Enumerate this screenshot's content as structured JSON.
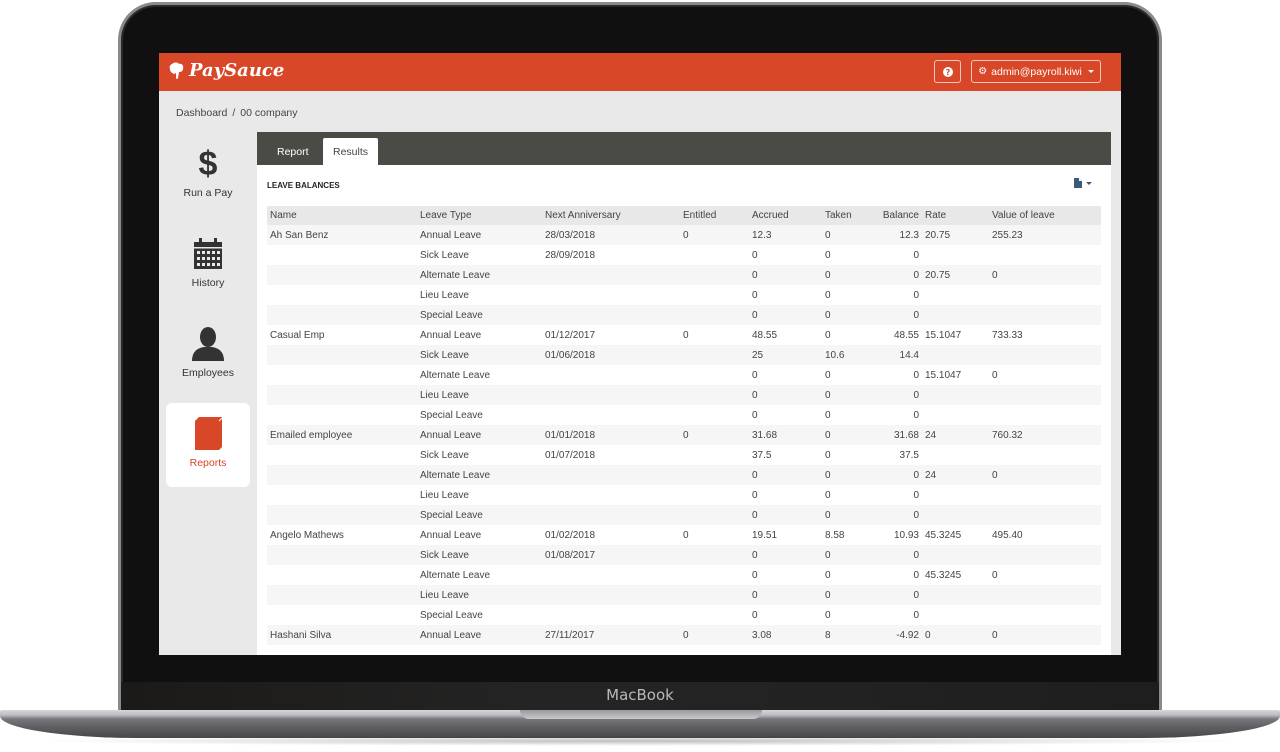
{
  "device": {
    "label": "MacBook"
  },
  "app": {
    "name": "PaySauce",
    "brand_color": "#d84727",
    "tab_bar_color": "#4b4b45"
  },
  "header": {
    "help_icon": "question-circle-icon",
    "user_menu": {
      "icon": "gear-icon",
      "label": "admin@payroll.kiwi"
    }
  },
  "breadcrumb": {
    "items": [
      "Dashboard",
      "/",
      "00 company"
    ]
  },
  "sidebar": {
    "items": [
      {
        "label": "Run a Pay",
        "icon": "dollar-icon",
        "active": false
      },
      {
        "label": "History",
        "icon": "calendar-icon",
        "active": false
      },
      {
        "label": "Employees",
        "icon": "person-icon",
        "active": false
      },
      {
        "label": "Reports",
        "icon": "book-icon",
        "active": true
      }
    ]
  },
  "main": {
    "tabs": [
      {
        "label": "Report",
        "active": false
      },
      {
        "label": "Results",
        "active": true
      }
    ],
    "section_title": "LEAVE BALANCES",
    "export_icon": "file-icon",
    "table": {
      "columns": [
        "Name",
        "Leave Type",
        "Next Anniversary",
        "Entitled",
        "Accrued",
        "Taken",
        "Balance",
        "Rate",
        "Value of leave"
      ],
      "rows": [
        [
          "Ah San Benz",
          "Annual Leave",
          "28/03/2018",
          "0",
          "12.3",
          "0",
          "12.3",
          "20.75",
          "255.23"
        ],
        [
          "",
          "Sick Leave",
          "28/09/2018",
          "",
          "0",
          "0",
          "0",
          "",
          ""
        ],
        [
          "",
          "Alternate Leave",
          "",
          "",
          "0",
          "0",
          "0",
          "20.75",
          "0"
        ],
        [
          "",
          "Lieu Leave",
          "",
          "",
          "0",
          "0",
          "0",
          "",
          ""
        ],
        [
          "",
          "Special Leave",
          "",
          "",
          "0",
          "0",
          "0",
          "",
          ""
        ],
        [
          "Casual Emp",
          "Annual Leave",
          "01/12/2017",
          "0",
          "48.55",
          "0",
          "48.55",
          "15.1047",
          "733.33"
        ],
        [
          "",
          "Sick Leave",
          "01/06/2018",
          "",
          "25",
          "10.6",
          "14.4",
          "",
          ""
        ],
        [
          "",
          "Alternate Leave",
          "",
          "",
          "0",
          "0",
          "0",
          "15.1047",
          "0"
        ],
        [
          "",
          "Lieu Leave",
          "",
          "",
          "0",
          "0",
          "0",
          "",
          ""
        ],
        [
          "",
          "Special Leave",
          "",
          "",
          "0",
          "0",
          "0",
          "",
          ""
        ],
        [
          "Emailed employee",
          "Annual Leave",
          "01/01/2018",
          "0",
          "31.68",
          "0",
          "31.68",
          "24",
          "760.32"
        ],
        [
          "",
          "Sick Leave",
          "01/07/2018",
          "",
          "37.5",
          "0",
          "37.5",
          "",
          ""
        ],
        [
          "",
          "Alternate Leave",
          "",
          "",
          "0",
          "0",
          "0",
          "24",
          "0"
        ],
        [
          "",
          "Lieu Leave",
          "",
          "",
          "0",
          "0",
          "0",
          "",
          ""
        ],
        [
          "",
          "Special Leave",
          "",
          "",
          "0",
          "0",
          "0",
          "",
          ""
        ],
        [
          "Angelo Mathews",
          "Annual Leave",
          "01/02/2018",
          "0",
          "19.51",
          "8.58",
          "10.93",
          "45.3245",
          "495.40"
        ],
        [
          "",
          "Sick Leave",
          "01/08/2017",
          "",
          "0",
          "0",
          "0",
          "",
          ""
        ],
        [
          "",
          "Alternate Leave",
          "",
          "",
          "0",
          "0",
          "0",
          "45.3245",
          "0"
        ],
        [
          "",
          "Lieu Leave",
          "",
          "",
          "0",
          "0",
          "0",
          "",
          ""
        ],
        [
          "",
          "Special Leave",
          "",
          "",
          "0",
          "0",
          "0",
          "",
          ""
        ],
        [
          "Hashani Silva",
          "Annual Leave",
          "27/11/2017",
          "0",
          "3.08",
          "8",
          "-4.92",
          "0",
          "0"
        ]
      ]
    }
  }
}
